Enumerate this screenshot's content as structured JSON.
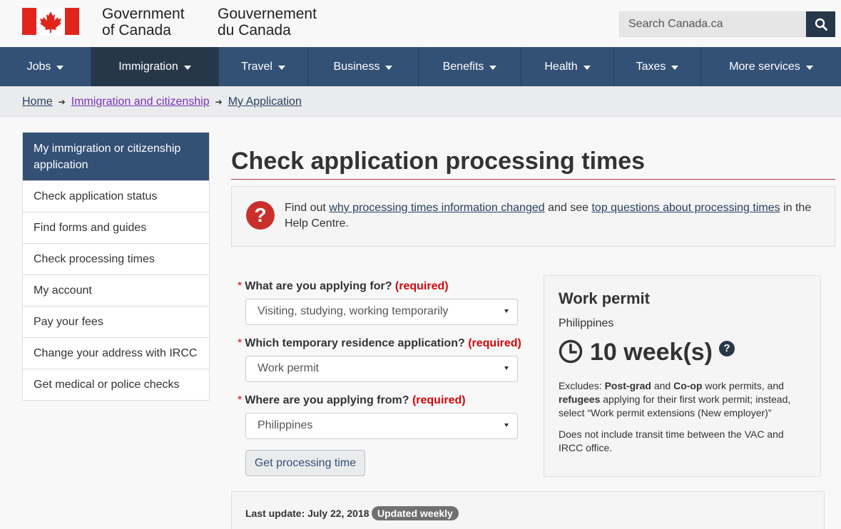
{
  "header": {
    "wordmark_en_1": "Government",
    "wordmark_en_2": "of Canada",
    "wordmark_fr_1": "Gouvernement",
    "wordmark_fr_2": "du Canada",
    "search_placeholder": "Search Canada.ca"
  },
  "nav": {
    "items": [
      {
        "label": "Jobs"
      },
      {
        "label": "Immigration"
      },
      {
        "label": "Travel"
      },
      {
        "label": "Business"
      },
      {
        "label": "Benefits"
      },
      {
        "label": "Health"
      },
      {
        "label": "Taxes"
      },
      {
        "label": "More services"
      }
    ]
  },
  "breadcrumb": {
    "items": [
      "Home",
      "Immigration and citizenship",
      "My Application"
    ]
  },
  "sidebar": {
    "heading": "My immigration or citizenship application",
    "items": [
      "Check application status",
      "Find forms and guides",
      "Check processing times",
      "My account",
      "Pay your fees",
      "Change your address with IRCC",
      "Get medical or police checks"
    ]
  },
  "main": {
    "title": "Check application processing times",
    "help": {
      "pre": "Find out ",
      "link1": "why processing times information changed",
      "mid": " and see ",
      "link2": "top questions about processing times",
      "post": " in the Help Centre."
    },
    "form": {
      "q1_label": "What are you applying for?",
      "q1_value": "Visiting, studying, working temporarily",
      "q2_label": "Which temporary residence application?",
      "q2_value": "Work permit",
      "q3_label": "Where are you applying from?",
      "q3_value": "Philippines",
      "required_text": "(required)",
      "required_star": "*",
      "submit_label": "Get processing time"
    },
    "result": {
      "title": "Work permit",
      "country": "Philippines",
      "time": "10 week(s)",
      "note1_a": "Excludes: ",
      "note1_b": "Post-grad",
      "note1_c": " and ",
      "note1_d": "Co-op",
      "note1_e": " work permits, and ",
      "note1_f": "refugees",
      "note1_g": " applying for their first work permit; instead, select “Work permit extensions (New employer)”",
      "note2": "Does not include transit time between the VAC and IRCC office."
    },
    "update": {
      "label": "Last update: July 22, 2018",
      "badge": "Updated weekly"
    }
  },
  "colors": {
    "nav_bg": "#335075",
    "nav_active": "#26374a",
    "required_red": "#d3080c",
    "title_rule": "#af3c43",
    "link": "#284162",
    "visited_link": "#7834bc"
  }
}
